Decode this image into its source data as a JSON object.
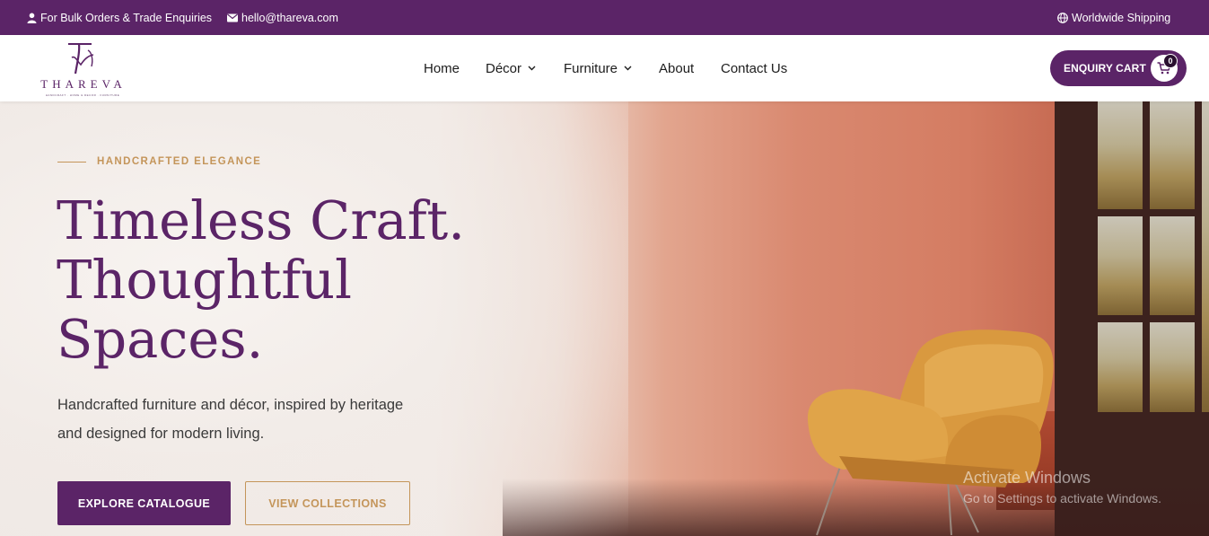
{
  "topbar": {
    "bulk_text": "For Bulk Orders & Trade Enquiries",
    "email": "hello@thareva.com",
    "shipping": "Worldwide Shipping"
  },
  "header": {
    "logo_word": "THAREVA",
    "logo_tagline": "HANDCRAFT · HOME & DECOR · FURNITURE",
    "nav": {
      "home": "Home",
      "decor": "Décor",
      "furniture": "Furniture",
      "about": "About",
      "contact": "Contact Us"
    },
    "cart_label": "ENQUIRY CART",
    "cart_count": "0"
  },
  "hero": {
    "kicker": "HANDCRAFTED ELEGANCE",
    "headline_line1": "Timeless Craft.",
    "headline_line2": "Thoughtful",
    "headline_line3": "Spaces.",
    "sub_line1": "Handcrafted furniture and décor, inspired by heritage",
    "sub_line2": "and designed for modern living.",
    "cta_primary": "EXPLORE CATALOGUE",
    "cta_secondary": "VIEW COLLECTIONS"
  },
  "watermark": {
    "title": "Activate Windows",
    "subtitle": "Go to Settings to activate Windows."
  },
  "colors": {
    "brand_purple": "#5b2467",
    "accent_gold": "#c4955a"
  }
}
